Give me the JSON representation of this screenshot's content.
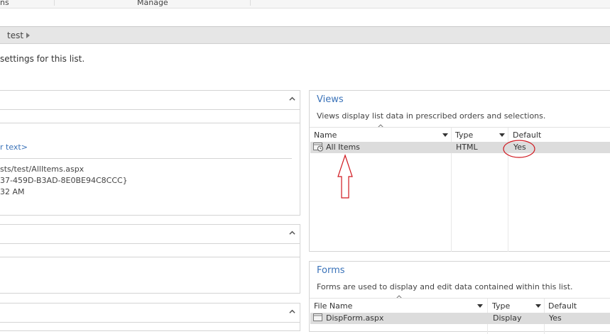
{
  "ribbon": {
    "tab_left": "ns",
    "tab_manage": "Manage"
  },
  "breadcrumb": {
    "current": "test"
  },
  "page": {
    "description": "settings for this list."
  },
  "left": {
    "link_text": "r text>",
    "url": "sts/test/AllItems.aspx",
    "guid": "37-459D-B3AD-8E0BE94C8CCC}",
    "time": "32 AM"
  },
  "views": {
    "title": "Views",
    "description": "Views display list data in prescribed orders and selections.",
    "columns": [
      "Name",
      "Type",
      "Default"
    ],
    "rows": [
      {
        "name": "All Items",
        "type": "HTML",
        "default": "Yes"
      }
    ]
  },
  "forms": {
    "title": "Forms",
    "description": "Forms are used to display and edit data contained within this list.",
    "columns": [
      "File Name",
      "Type",
      "Default"
    ],
    "rows": [
      {
        "name": "DispForm.aspx",
        "type": "Display",
        "default": "Yes"
      }
    ]
  },
  "colors": {
    "accent": "#3b73b9",
    "annotation": "#d0181f",
    "row_selected": "#dcdcdc"
  }
}
